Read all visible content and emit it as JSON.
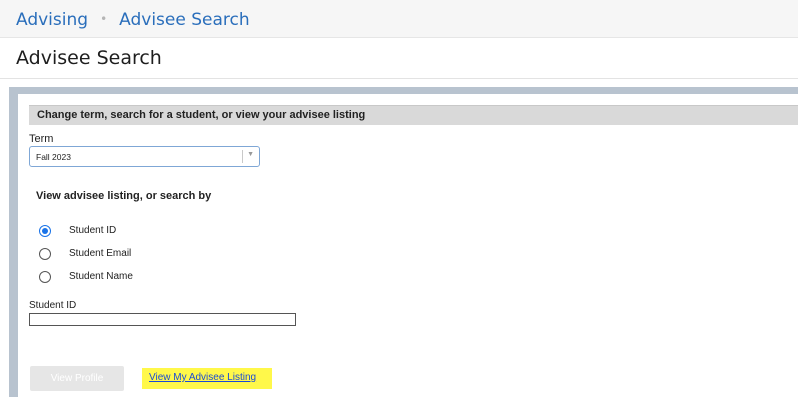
{
  "breadcrumb": {
    "root": "Advising",
    "separator": "•",
    "current": "Advisee Search"
  },
  "page": {
    "title": "Advisee Search"
  },
  "panel": {
    "header": "Change term, search for a student, or view your advisee listing",
    "term": {
      "label": "Term",
      "value": "Fall 2023"
    },
    "search_by_label": "View advisee listing, or search by",
    "search_options": [
      {
        "label": "Student ID",
        "selected": true
      },
      {
        "label": "Student Email",
        "selected": false
      },
      {
        "label": "Student Name",
        "selected": false
      }
    ],
    "student_id": {
      "label": "Student ID",
      "value": ""
    },
    "view_profile_button": "View Profile",
    "advisee_listing_link": "View My Advisee Listing"
  },
  "colors": {
    "accent": "#2a6ebb",
    "radio": "#1a73e8",
    "highlight": "#fff84a",
    "link": "#1a4bd6"
  }
}
